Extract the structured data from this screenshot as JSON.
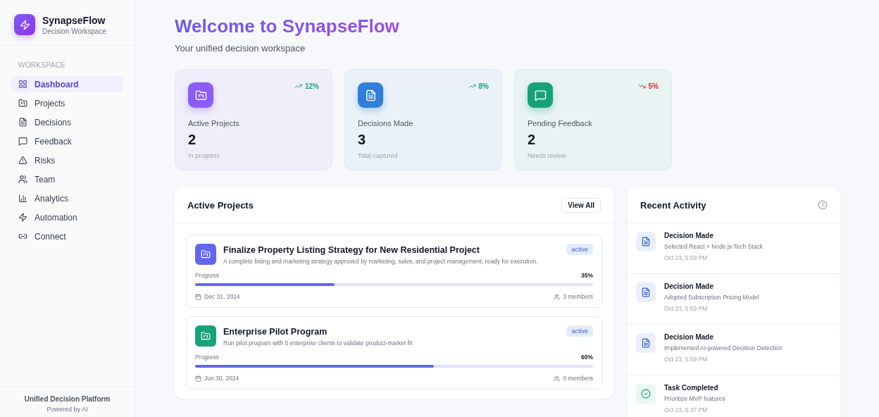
{
  "brand": {
    "name": "SynapseFlow",
    "subtitle": "Decision Workspace"
  },
  "sidebar": {
    "section": "WORKSPACE",
    "items": [
      {
        "label": "Dashboard",
        "selected": true
      },
      {
        "label": "Projects",
        "selected": false
      },
      {
        "label": "Decisions",
        "selected": false
      },
      {
        "label": "Feedback",
        "selected": false
      },
      {
        "label": "Risks",
        "selected": false
      },
      {
        "label": "Team",
        "selected": false
      },
      {
        "label": "Analytics",
        "selected": false
      },
      {
        "label": "Automation",
        "selected": false
      },
      {
        "label": "Connect",
        "selected": false
      }
    ],
    "footer": {
      "title": "Unified Decision Platform",
      "subtitle": "Powered by AI"
    }
  },
  "header": {
    "title": "Welcome to SynapseFlow",
    "subtitle": "Your unified decision workspace"
  },
  "stats": [
    {
      "label": "Active Projects",
      "value": "2",
      "note": "In progress",
      "trend": "12%",
      "kind": "up",
      "color": "#8b5cf6"
    },
    {
      "label": "Decisions Made",
      "value": "3",
      "note": "Total captured",
      "trend": "8%",
      "kind": "up",
      "color": "#2f80d8"
    },
    {
      "label": "Pending Feedback",
      "value": "2",
      "note": "Needs review",
      "trend": "5%",
      "kind": "down",
      "color": "#16a37a"
    }
  ],
  "projects": {
    "title": "Active Projects",
    "action": "View All",
    "items": [
      {
        "title": "Finalize Property Listing Strategy for New Residential Project",
        "description": "A complete listing and marketing strategy approved by marketing, sales, and project management, ready for execution.",
        "status": "active",
        "progress_label": "Progress",
        "progress": "35%",
        "level": 0.35,
        "date": "Dec 31, 2024",
        "members": "3 members",
        "color": "#6366f1"
      },
      {
        "title": "Enterprise Pilot Program",
        "description": "Run pilot program with 5 enterprise clients to validate product-market fit",
        "status": "active",
        "progress_label": "Progress",
        "progress": "60%",
        "level": 0.6,
        "date": "Jun 30, 2024",
        "members": "0 members",
        "color": "#16a37a"
      }
    ]
  },
  "activity": {
    "title": "Recent Activity",
    "items": [
      {
        "kind": "decision",
        "title": "Decision Made",
        "detail": "Selected React + Node.js Tech Stack",
        "time": "Oct 23, 5:59 PM"
      },
      {
        "kind": "decision",
        "title": "Decision Made",
        "detail": "Adopted Subscription Pricing Model",
        "time": "Oct 23, 5:59 PM"
      },
      {
        "kind": "decision",
        "title": "Decision Made",
        "detail": "Implemented AI-powered Decision Detection",
        "time": "Oct 23, 5:59 PM"
      },
      {
        "kind": "task",
        "title": "Task Completed",
        "detail": "Prioritize MVP features",
        "time": "Oct 23, 5:37 PM"
      }
    ]
  }
}
